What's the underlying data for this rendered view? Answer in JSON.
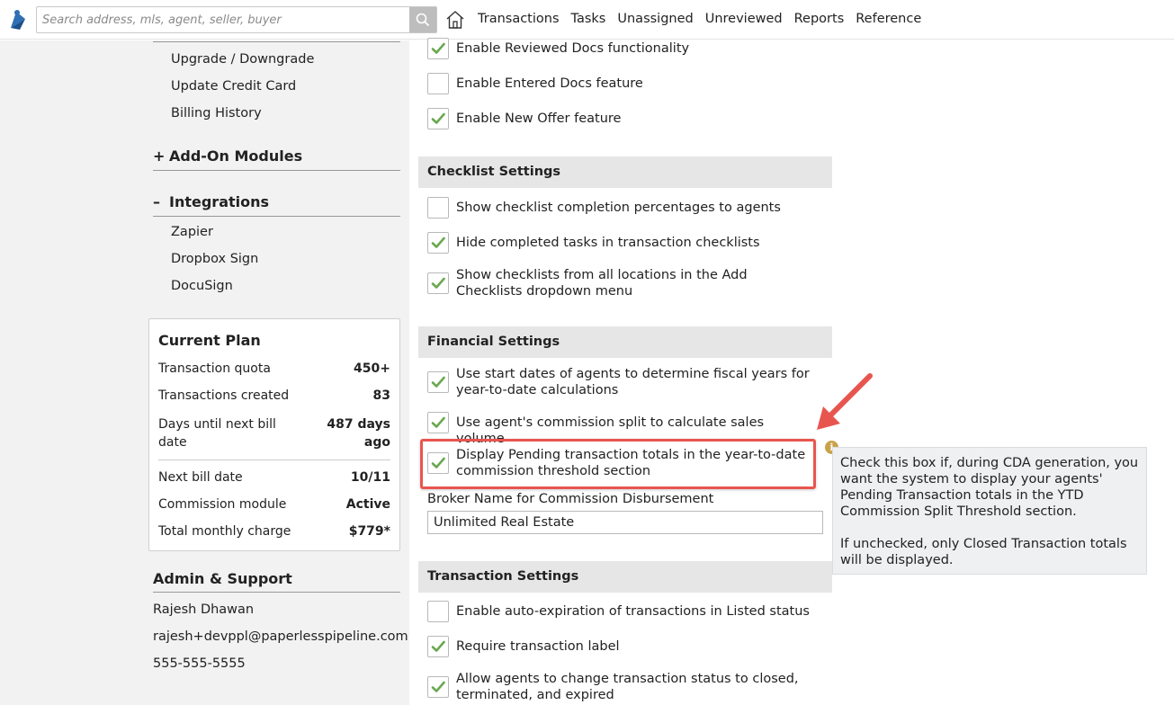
{
  "topbar": {
    "search_placeholder": "Search address, mls, agent, seller, buyer",
    "nav": [
      "Transactions",
      "Tasks",
      "Unassigned",
      "Unreviewed",
      "Reports",
      "Reference"
    ]
  },
  "sidebar": {
    "billing_links": [
      "Upgrade / Downgrade",
      "Update Credit Card",
      "Billing History"
    ],
    "addon_section": {
      "sign": "+",
      "title": "Add-On Modules"
    },
    "integrations_section": {
      "sign": "–",
      "title": "Integrations"
    },
    "integration_links": [
      "Zapier",
      "Dropbox Sign",
      "DocuSign"
    ],
    "plan": {
      "title": "Current Plan",
      "rows": [
        {
          "label": "Transaction quota",
          "value": "450+"
        },
        {
          "label": "Transactions created",
          "value": "83"
        },
        {
          "label": "Days until next bill date",
          "value": "487 days ago"
        },
        {
          "label": "Next bill date",
          "value": "10/11"
        },
        {
          "label": "Commission module",
          "value": "Active"
        },
        {
          "label": "Total monthly charge",
          "value": "$779*"
        }
      ]
    },
    "admin": {
      "title": "Admin & Support",
      "name": "Rajesh Dhawan",
      "email": "rajesh+devppl@paperlesspipeline.com",
      "phone": "555-555-5555"
    }
  },
  "main": {
    "top_options": [
      {
        "label": "Enable Reviewed Docs functionality",
        "checked": true
      },
      {
        "label": "Enable Entered Docs feature",
        "checked": false
      },
      {
        "label": "Enable New Offer feature",
        "checked": true
      }
    ],
    "checklist_section": {
      "title": "Checklist Settings",
      "options": [
        {
          "label": "Show checklist completion percentages to agents",
          "checked": false
        },
        {
          "label": "Hide completed tasks in transaction checklists",
          "checked": true
        },
        {
          "label": "Show checklists from all locations in the Add Checklists dropdown menu",
          "checked": true
        }
      ]
    },
    "financial_section": {
      "title": "Financial Settings",
      "options": [
        {
          "label": "Use start dates of agents to determine fiscal years for year-to-date calculations",
          "checked": true
        },
        {
          "label": "Use agent's commission split to calculate sales volume",
          "checked": true
        },
        {
          "label": "Display Pending transaction totals in the year-to-date commission threshold section",
          "checked": true
        }
      ],
      "broker_label": "Broker Name for Commission Disbursement",
      "broker_value": "Unlimited Real Estate"
    },
    "transaction_section": {
      "title": "Transaction Settings",
      "options": [
        {
          "label": "Enable auto-expiration of transactions in Listed status",
          "checked": false
        },
        {
          "label": "Require transaction label",
          "checked": true
        },
        {
          "label": "Allow agents to change transaction status to closed, terminated, and expired",
          "checked": true
        }
      ]
    },
    "tooltip": {
      "icon": "i",
      "para1": "Check this box if, during CDA generation, you want the system to display your agents' Pending Transaction totals in the YTD Commission Split Threshold section.",
      "para2": "If unchecked, only Closed Transaction totals will be displayed."
    }
  },
  "colors": {
    "check_green": "#6aa84f",
    "highlight_red": "#e8554f",
    "logo_blue": "#2f6fb5"
  }
}
